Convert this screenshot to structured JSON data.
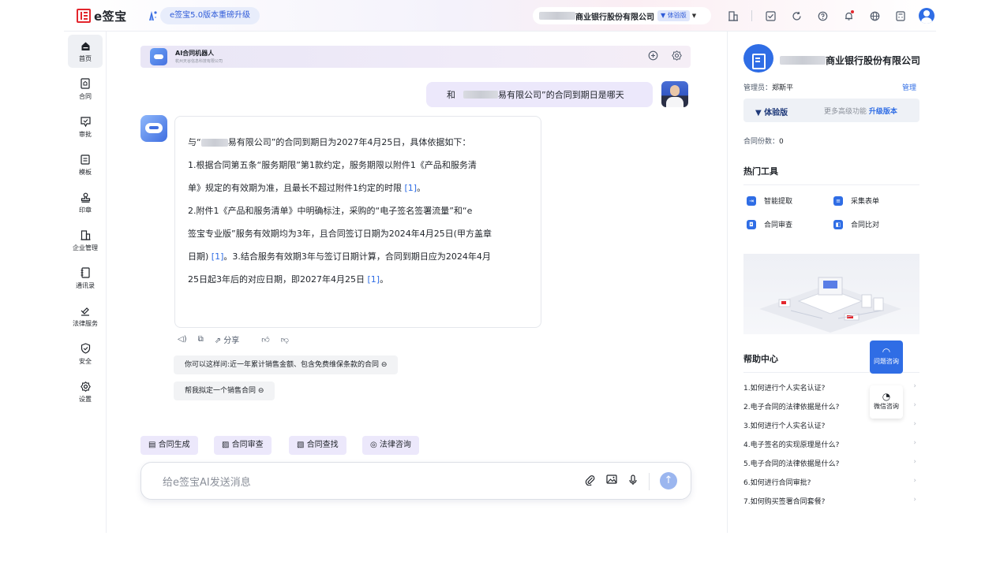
{
  "header": {
    "logo_text": "e签宝",
    "upgrade_label": "e签宝5.0版本重磅升级",
    "company_name": "商业银行股份有限公司",
    "version_badge": "体验版"
  },
  "sidebar": {
    "items": [
      {
        "label": "首页",
        "icon": "home-icon"
      },
      {
        "label": "合同",
        "icon": "contract-icon"
      },
      {
        "label": "审批",
        "icon": "approval-icon"
      },
      {
        "label": "模板",
        "icon": "template-icon"
      },
      {
        "label": "印章",
        "icon": "seal-icon"
      },
      {
        "label": "企业管理",
        "icon": "enterprise-icon"
      },
      {
        "label": "通讯录",
        "icon": "contacts-icon"
      },
      {
        "label": "法律服务",
        "icon": "legal-icon"
      },
      {
        "label": "安全",
        "icon": "security-icon"
      },
      {
        "label": "设置",
        "icon": "settings-icon"
      }
    ]
  },
  "chat": {
    "bot_name": "AI合同机器人",
    "bot_company": "杭州天谷信息科技有限公司",
    "user_question_prefix": "和",
    "user_question_suffix": "易有限公司”的合同到期日是哪天",
    "answer": {
      "line1_prefix": "与“",
      "line1_suffix": "易有限公司”的合同到期日为2027年4月25日，具体依据如下：",
      "line2": "1.根据合同第五条“服务期限”第1款约定，服务期限以附件1《产品和服务清",
      "line3": "单》规定的有效期为准，且最长不超过附件1约定的时限",
      "line4": "2.附件1《产品和服务清单》中明确标注，采购的“电子签名签署流量”和“e",
      "line5": "签宝专业版”服务有效期均为3年，且合同签订日期为2024年4月25日(甲方盖章",
      "line6a": "日期)",
      "line6b": "。3.结合服务有效期3年与签订日期计算，合同到期日应为2024年4月",
      "line7": "25日起3年后的对应日期，即2027年4月25日",
      "ref": "[1]",
      "period": "。"
    },
    "actions": {
      "share": "分享"
    },
    "suggestions": [
      "你可以这样问:近一年累计销售金额、包含免费维保条款的合同",
      "帮我拟定一个销售合同"
    ],
    "quick_actions": [
      "合同生成",
      "合同审查",
      "合同查找",
      "法律咨询"
    ],
    "composer_placeholder": "给e签宝AI发送消息"
  },
  "right_panel": {
    "company_name": "银行股份有限公司",
    "company_mid": "商业",
    "admin_label": "管理员：",
    "admin_name": "郑斯平",
    "manage": "管理",
    "version": "体验版",
    "more_features": "更多高级功能",
    "upgrade": "升级版本",
    "contract_count_label": "合同份数：",
    "contract_count": "0",
    "hot_tools_title": "热门工具",
    "tools": [
      "智能提取",
      "采集表单",
      "合同审查",
      "合同比对"
    ],
    "help_title": "帮助中心",
    "help_link": "帮助",
    "faq": [
      "1.如何进行个人实名认证?",
      "2.电子合同的法律依据是什么?",
      "3.如何进行个人实名认证?",
      "4.电子签名的实现原理是什么?",
      "5.电子合同的法律依据是什么?",
      "6.如何进行合同审批?",
      "7.如何购买签署合同套餐?"
    ]
  },
  "floating": {
    "consult": "问题咨询",
    "wechat": "微信咨询"
  },
  "colors": {
    "accent": "#2f6de5",
    "brand_red": "#e3262d",
    "bubble": "#ece8fb"
  }
}
